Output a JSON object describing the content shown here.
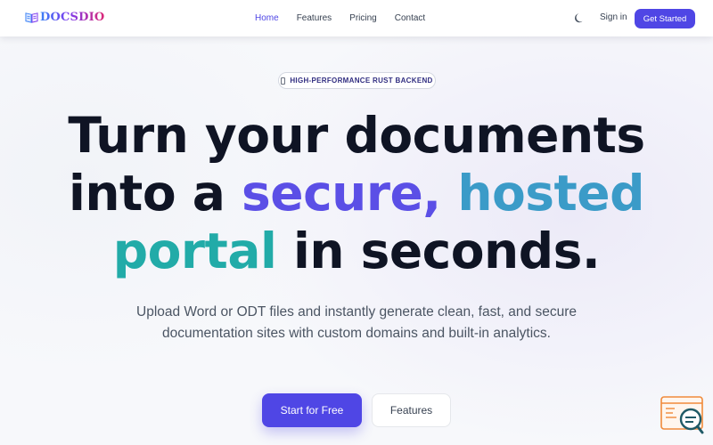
{
  "brand": {
    "name": "DOCSDIO",
    "icon": "book-icon"
  },
  "nav": {
    "links": [
      {
        "label": "Home",
        "active": true
      },
      {
        "label": "Features",
        "active": false
      },
      {
        "label": "Pricing",
        "active": false
      },
      {
        "label": "Contact",
        "active": false
      }
    ],
    "theme_toggle_icon": "moon-icon",
    "signin_label": "Sign in",
    "get_started_label": "Get Started"
  },
  "hero": {
    "badge": "HIGH-PERFORMANCE RUST BACKEND",
    "headline": {
      "line1": "Turn your documents",
      "line2_a": "into a ",
      "line2_b": "secure,",
      "line2_c": "hosted",
      "line3_a": "portal",
      "line3_b": " in seconds."
    },
    "subheadline": "Upload Word or ODT files and instantly generate clean, fast, and secure documentation sites with custom domains and built-in analytics.",
    "primary_cta": "Start for Free",
    "secondary_cta": "Features"
  },
  "widget": {
    "icon": "search-chat-icon"
  },
  "colors": {
    "accent": "#4f46e5",
    "headline_purple": "#5b4fe6",
    "headline_blue": "#3b9bc8",
    "headline_teal": "#22aba8"
  }
}
